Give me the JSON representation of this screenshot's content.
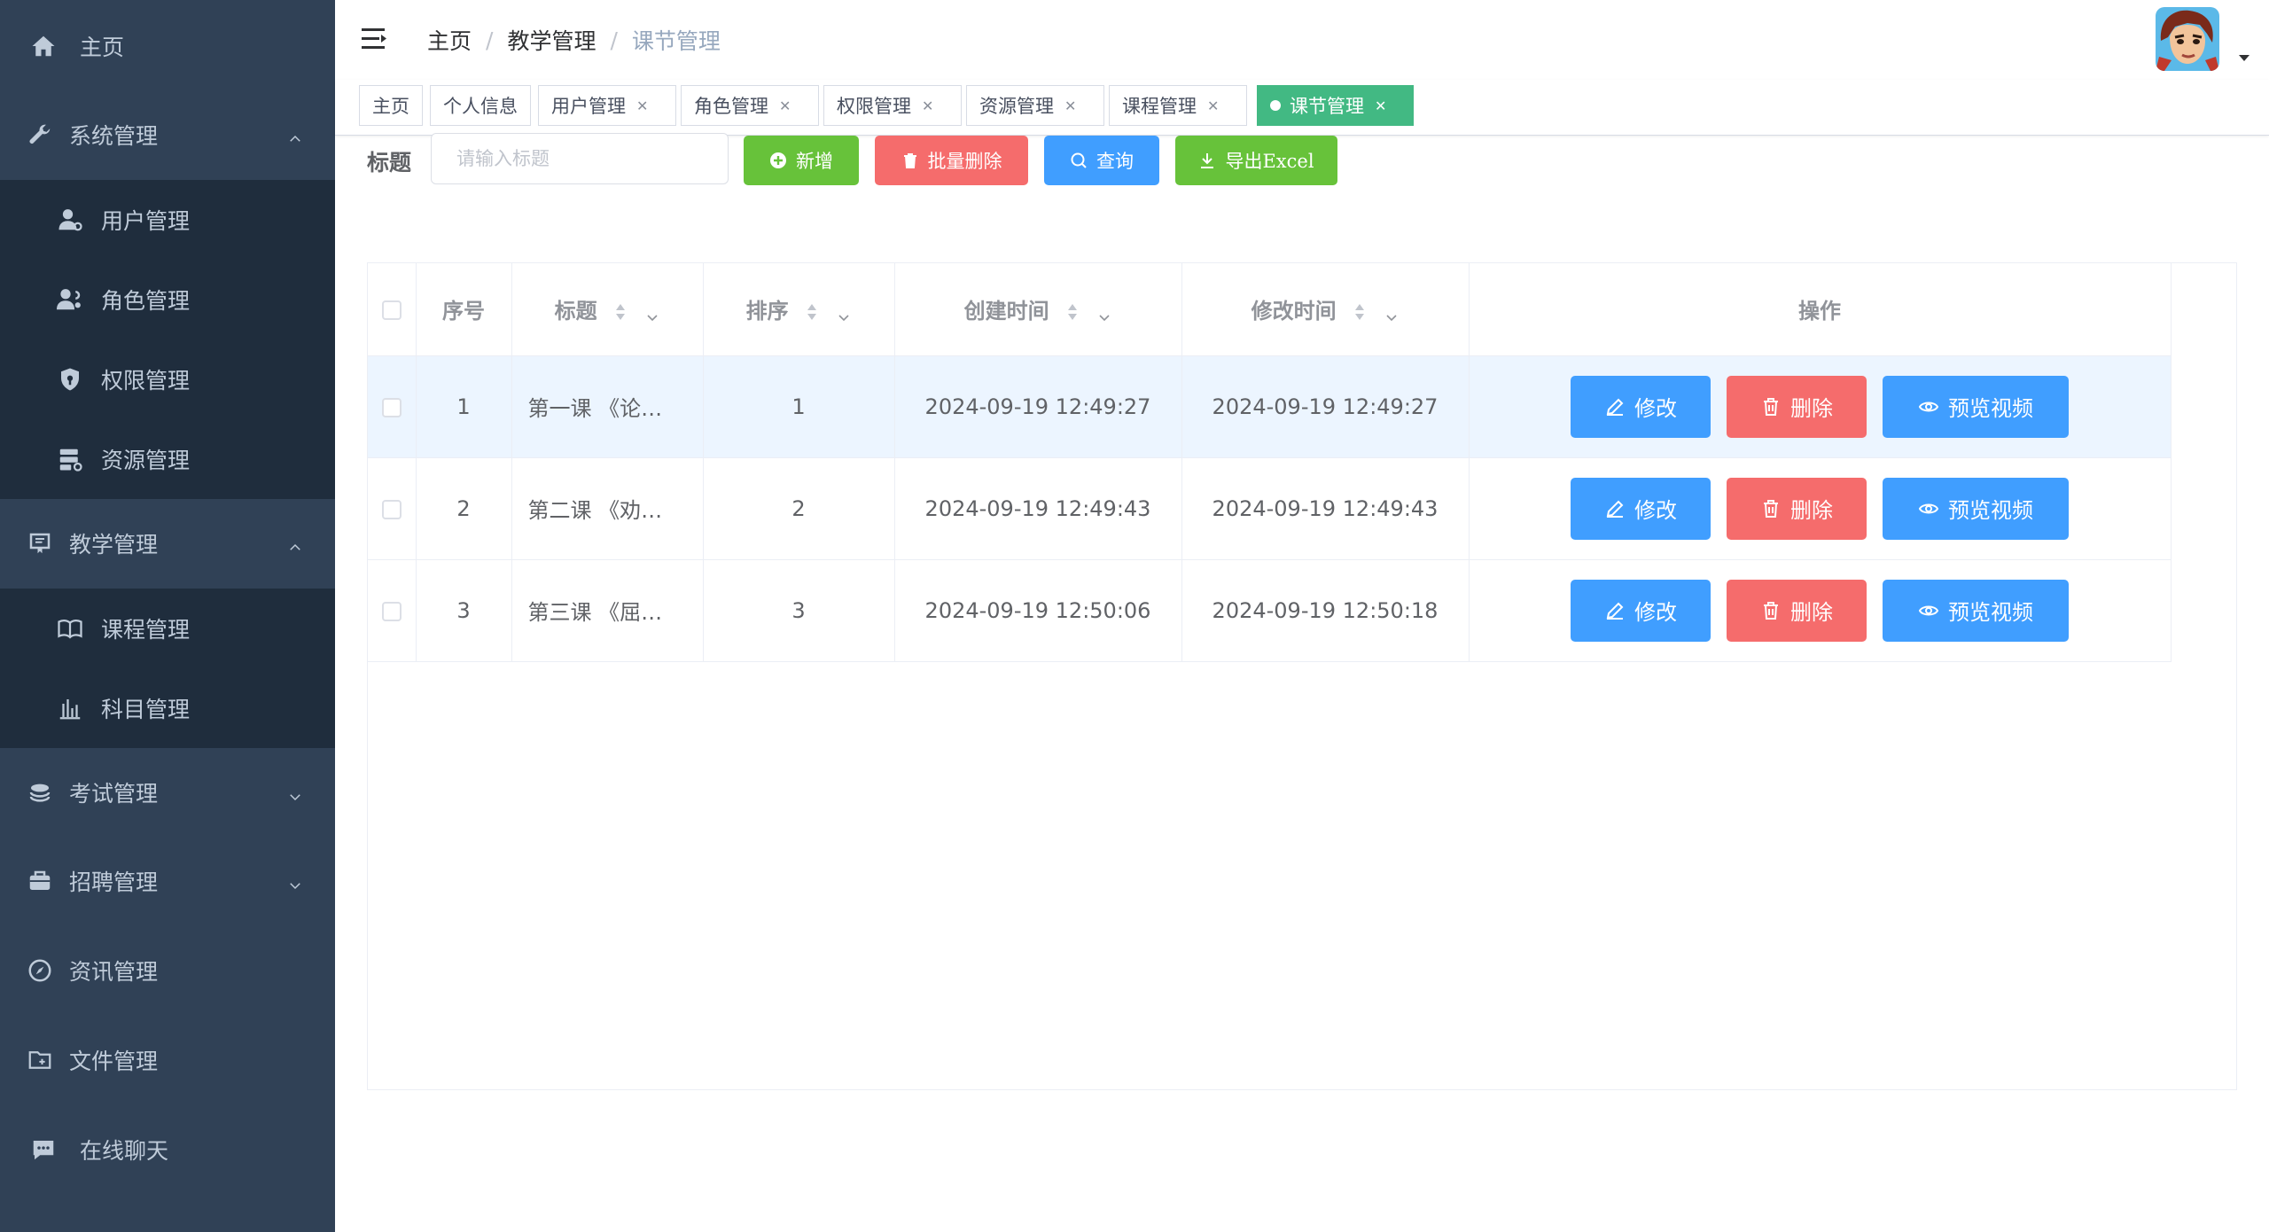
{
  "sidebar": {
    "items": [
      {
        "label": "主页",
        "icon": "home-icon"
      },
      {
        "label": "系统管理",
        "icon": "wrench-icon",
        "expanded": true
      },
      {
        "label": "用户管理",
        "icon": "user-icon"
      },
      {
        "label": "角色管理",
        "icon": "role-icon"
      },
      {
        "label": "权限管理",
        "icon": "shield-icon"
      },
      {
        "label": "资源管理",
        "icon": "server-icon"
      },
      {
        "label": "教学管理",
        "icon": "book-icon",
        "expanded": true
      },
      {
        "label": "课程管理",
        "icon": "reading-icon"
      },
      {
        "label": "科目管理",
        "icon": "chart-icon"
      },
      {
        "label": "考试管理",
        "icon": "coins-icon",
        "expanded": false
      },
      {
        "label": "招聘管理",
        "icon": "briefcase-icon",
        "expanded": false
      },
      {
        "label": "资讯管理",
        "icon": "compass-icon"
      },
      {
        "label": "文件管理",
        "icon": "folder-icon"
      },
      {
        "label": "在线聊天",
        "icon": "chat-icon"
      }
    ]
  },
  "header": {
    "breadcrumb": [
      "主页",
      "教学管理",
      "课节管理"
    ],
    "separator": "/"
  },
  "tags": [
    {
      "label": "主页",
      "closable": false
    },
    {
      "label": "个人信息",
      "closable": false
    },
    {
      "label": "用户管理",
      "closable": true
    },
    {
      "label": "角色管理",
      "closable": true
    },
    {
      "label": "权限管理",
      "closable": true
    },
    {
      "label": "资源管理",
      "closable": true
    },
    {
      "label": "课程管理",
      "closable": true
    },
    {
      "label": "课节管理",
      "closable": true,
      "active": true
    }
  ],
  "toolbar": {
    "title_label": "标题",
    "search_placeholder": "请输入标题",
    "add_label": "新增",
    "batch_delete_label": "批量删除",
    "query_label": "查询",
    "export_label": "导出Excel"
  },
  "table": {
    "columns": [
      "序号",
      "标题",
      "排序",
      "创建时间",
      "修改时间",
      "操作"
    ],
    "rows": [
      {
        "index": "1",
        "title": "第一课 《论…",
        "sort": "1",
        "created": "2024-09-19 12:49:27",
        "modified": "2024-09-19 12:49:27"
      },
      {
        "index": "2",
        "title": "第二课 《劝…",
        "sort": "2",
        "created": "2024-09-19 12:49:43",
        "modified": "2024-09-19 12:49:43"
      },
      {
        "index": "3",
        "title": "第三课 《屈…",
        "sort": "3",
        "created": "2024-09-19 12:50:06",
        "modified": "2024-09-19 12:50:18"
      }
    ],
    "edit_label": "修改",
    "delete_label": "删除",
    "preview_label": "预览视频"
  },
  "colors": {
    "sidebar_bg": "#304156",
    "submenu_bg": "#1f2d3d",
    "primary": "#409eff",
    "success": "#67c23a",
    "danger": "#f56c6c",
    "active_tag": "#42b983",
    "row_highlight": "#ecf5ff"
  }
}
